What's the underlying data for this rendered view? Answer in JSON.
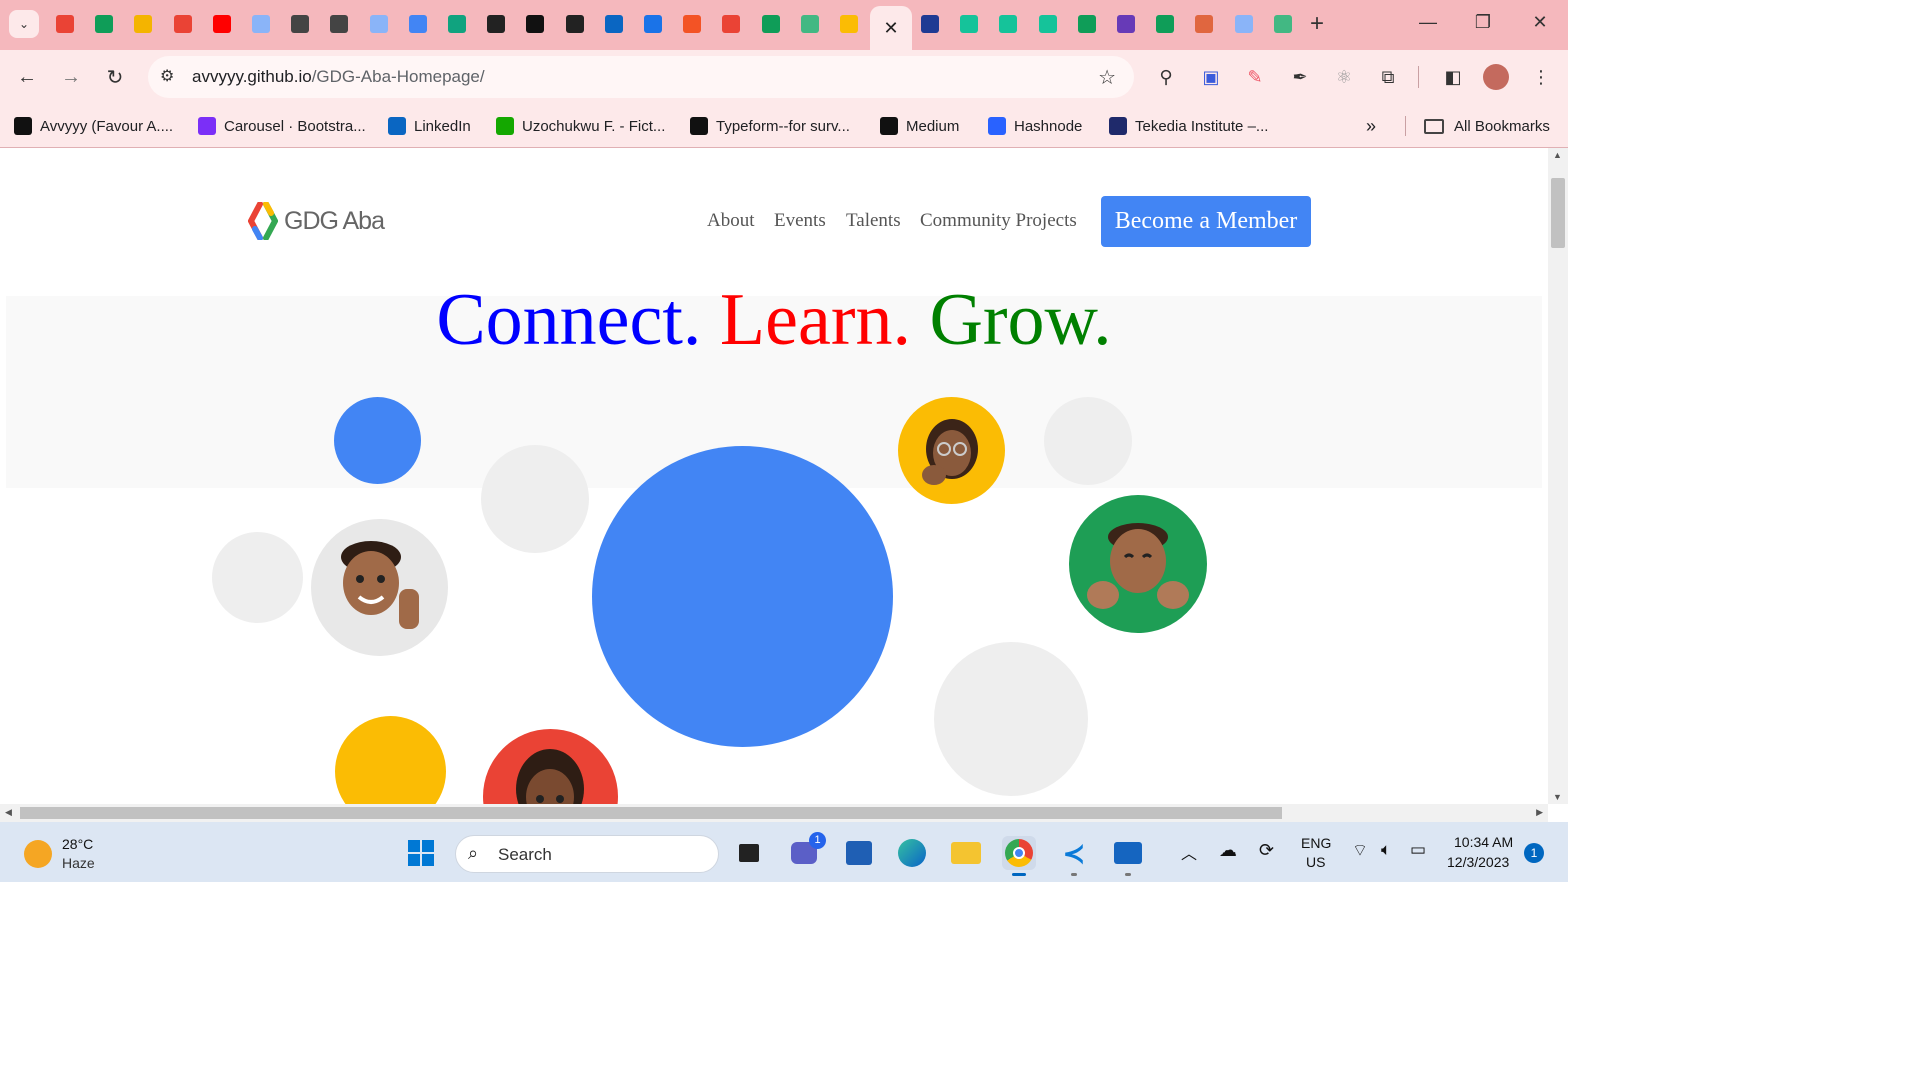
{
  "browser": {
    "tab_favicons": [
      "gmail",
      "sheets",
      "slides",
      "gmail",
      "youtube",
      "bulb",
      "chrome-web",
      "chrome-web",
      "spark",
      "docs",
      "chatgpt",
      "alx",
      "terminal",
      "alx",
      "linkedin",
      "tie",
      "microsoft",
      "target",
      "sheets",
      "vue",
      "bulb-yellow",
      "active",
      "ms-blue",
      "grammarly",
      "grammarly",
      "grammarly",
      "sheets",
      "forms",
      "sheets",
      "lips",
      "ufo",
      "vue"
    ],
    "new_tab_label": "+",
    "active_tab_close": "✕",
    "url_host": "avvyyy.github.io",
    "url_path": "/GDG-Aba-Homepage/",
    "bookmarks": [
      {
        "label": "Avvyyy (Favour A....",
        "icon": "github-icon",
        "color": "#111111"
      },
      {
        "label": "Carousel · Bootstra...",
        "icon": "bootstrap-icon",
        "color": "#7b2ff7"
      },
      {
        "label": "LinkedIn",
        "icon": "linkedin-icon",
        "color": "#0a66c2"
      },
      {
        "label": "Uzochukwu F. - Fict...",
        "icon": "upwork-icon",
        "color": "#14a800"
      },
      {
        "label": "Typeform--for surv...",
        "icon": "typeform-icon",
        "color": "#111111"
      },
      {
        "label": "Medium",
        "icon": "medium-icon",
        "color": "#111111"
      },
      {
        "label": "Hashnode",
        "icon": "hashnode-icon",
        "color": "#2962ff"
      },
      {
        "label": "Tekedia Institute –...",
        "icon": "tekedia-icon",
        "color": "#1f2a6b"
      }
    ],
    "more_bookmarks": "»",
    "all_bookmarks_label": "All Bookmarks"
  },
  "site": {
    "logo_text": "GDG Aba",
    "nav": [
      "About",
      "Events",
      "Talents",
      "Community Projects"
    ],
    "cta": "Become a Member",
    "tagline": [
      {
        "text": "Connect.",
        "color": "#0000ff"
      },
      {
        "text": "Learn.",
        "color": "#ff0000"
      },
      {
        "text": "Grow.",
        "color": "#008000"
      }
    ],
    "colors": {
      "blue": "#4285f4",
      "yellow": "#fbbc04",
      "green": "#1e9e55",
      "red": "#ea4335",
      "grey": "#eeeeee"
    }
  },
  "taskbar": {
    "weather_temp": "28°C",
    "weather_desc": "Haze",
    "search_placeholder": "Search",
    "teams_badge": "1",
    "lang_line1": "ENG",
    "lang_line2": "US",
    "time": "10:34 AM",
    "date": "12/3/2023",
    "notification_count": "1"
  }
}
